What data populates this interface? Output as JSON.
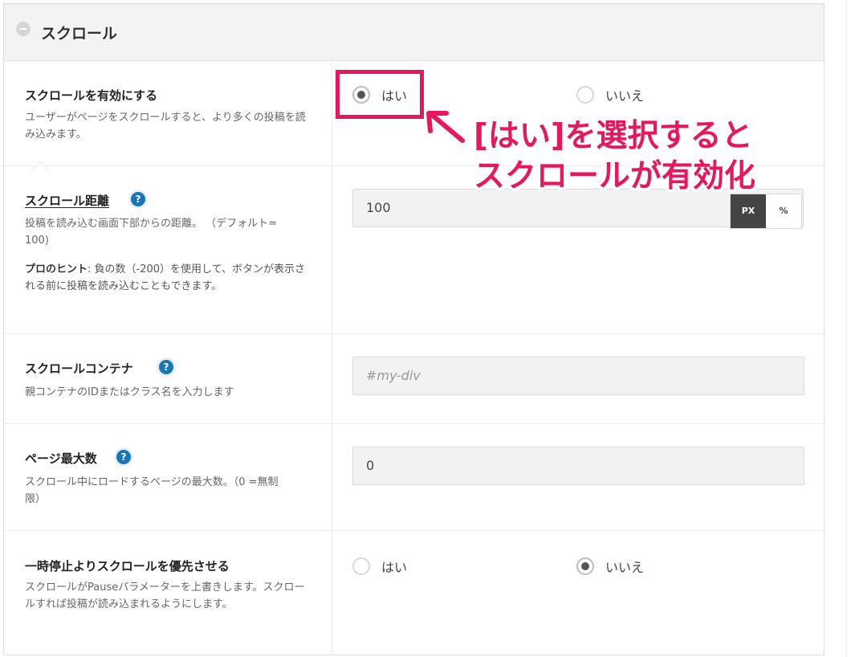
{
  "section": {
    "title": "スクロール"
  },
  "rows": {
    "enable_scroll": {
      "label": "スクロールを有効にする",
      "desc": "ユーザーがページをスクロールすると、より多くの投稿を読み込みます。",
      "options": [
        "はい",
        "いいえ"
      ],
      "selected": "はい"
    },
    "scroll_distance": {
      "label": "スクロール距離",
      "help": "?",
      "desc": "投稿を読み込む画面下部からの距離。 （デフォルト= 100)",
      "tip_label": "プロのヒント",
      "tip_text": ": 負の数（-200）を使用して、ボタンが表示される前に投稿を読み込むこともできます。",
      "value": "100",
      "units": [
        "PX",
        "%"
      ],
      "selected_unit": "PX"
    },
    "scroll_container": {
      "label": "スクロールコンテナ",
      "help": "?",
      "desc": "親コンテナのIDまたはクラス名を入力します",
      "placeholder": "#my-div"
    },
    "max_pages": {
      "label": "ページ最大数",
      "help": "?",
      "desc": "スクロール中にロードするページの最大数。（0 =無制限）",
      "value": "0"
    },
    "scroll_override": {
      "label": "一時停止よりスクロールを優先させる",
      "desc": "スクロールがPauseパラメーターを上書きします。スクロールすれば投稿が読み込まれるようにします。",
      "options": [
        "はい",
        "いいえ"
      ],
      "selected": "いいえ"
    }
  },
  "annotation": {
    "line1": "[はい]を選択すると",
    "line2": "スクロールが有効化",
    "color": "#e8175d"
  }
}
